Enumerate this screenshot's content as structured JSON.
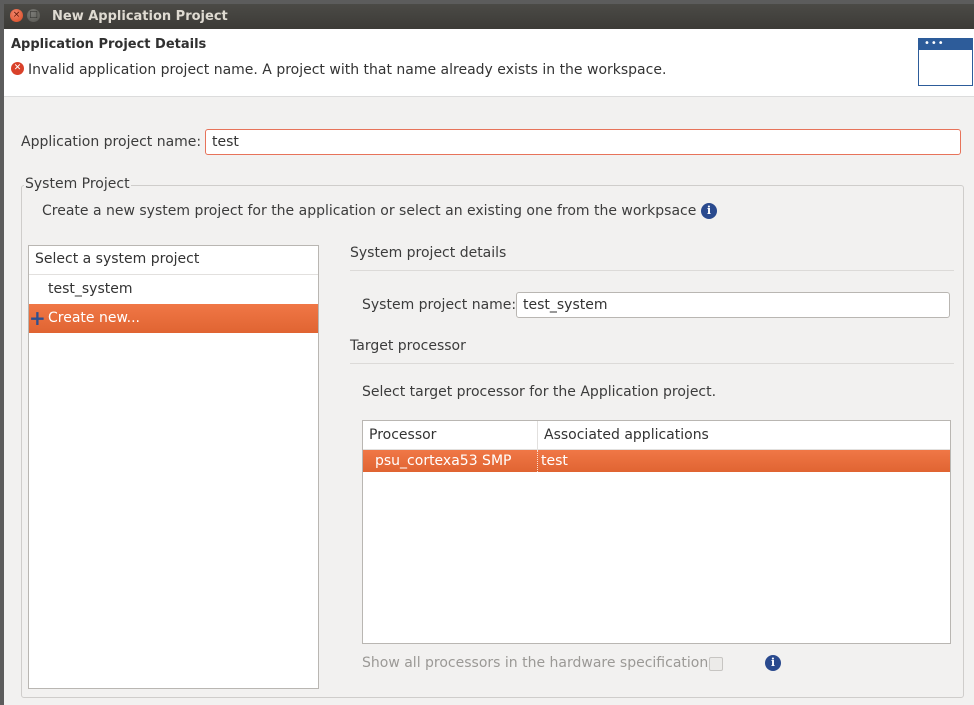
{
  "window": {
    "title": "New Application Project",
    "close_glyph": "×",
    "maximize_glyph": "□"
  },
  "header": {
    "title": "Application Project Details",
    "error_message": "Invalid application project name. A project with that name already exists in the workspace.",
    "error_glyph": "✕",
    "wizard_icon": "wizard-window-icon"
  },
  "app_project": {
    "label": "Application project name:",
    "value": "test"
  },
  "system_project": {
    "legend": "System Project",
    "description": "Create a new system project for the application or select an existing one from the workpsace",
    "info_glyph": "i",
    "list": {
      "header": "Select a system project",
      "items": [
        {
          "label": "test_system"
        },
        {
          "label": "Create new...",
          "icon": "plus-icon",
          "glyph": "+"
        }
      ]
    },
    "details": {
      "heading": "System project details",
      "name_label": "System project name:",
      "name_value": "test_system",
      "target_heading": "Target processor",
      "target_description": "Select target processor for the Application project.",
      "table": {
        "columns": [
          "Processor",
          "Associated applications"
        ],
        "rows": [
          {
            "processor": "psu_cortexa53 SMP",
            "apps": "test"
          }
        ]
      },
      "show_all_label": "Show all processors in the hardware specification",
      "show_all_checked": false
    }
  },
  "colors": {
    "selection": "#e8693a",
    "error": "#d9412a",
    "info": "#2a4a8e",
    "titlebar": "#3c3b37"
  }
}
